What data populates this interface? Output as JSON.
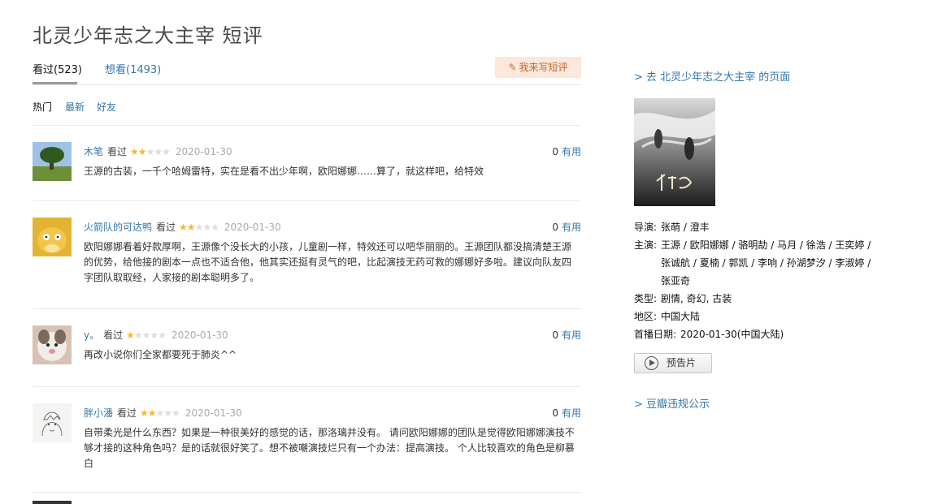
{
  "page": {
    "title": "北灵少年志之大主宰 短评"
  },
  "tabs": {
    "watched": "看过(523)",
    "want": "想看(1493)",
    "write_button": "我来写短评"
  },
  "sort": {
    "hot": "热门",
    "latest": "最新",
    "friends": "好友"
  },
  "comments": [
    {
      "user": "木笔",
      "status": "看过",
      "rating": 2,
      "date": "2020-01-30",
      "votes": "0",
      "votes_label": "有用",
      "text": "王源的古装，一千个哈姆雷特，实在是看不出少年啊，欧阳娜娜……算了，就这样吧，给特效"
    },
    {
      "user": "火箭队的可达鸭",
      "status": "看过",
      "rating": 2,
      "date": "2020-01-30",
      "votes": "0",
      "votes_label": "有用",
      "text": "欧阳娜娜看着好款厚啊，王源像个没长大的小孩，儿童剧一样，特效还可以吧华丽丽的。王源团队都没搞清楚王源的优势，给他接的剧本一点也不适合他，他其实还挺有灵气的吧，比起演技无药可救的娜娜好多啦。建议向队友四字团队取取经，人家接的剧本聪明多了。"
    },
    {
      "user": "y。",
      "status": "看过",
      "rating": 1,
      "date": "2020-01-30",
      "votes": "0",
      "votes_label": "有用",
      "text": "再改小说你们全家都要死于肺炎^^"
    },
    {
      "user": "胖小潘",
      "status": "看过",
      "rating": 2,
      "date": "2020-01-30",
      "votes": "0",
      "votes_label": "有用",
      "text": "自带柔光是什么东西？如果是一种很美好的感觉的话，那洛璃并没有。 请问欧阳娜娜的团队是觉得欧阳娜娜演技不够才接的这种角色吗？是的话就很好笑了。想不被嘲演技烂只有一个办法：提高演技。 个人比较喜欢的角色是柳慕白"
    }
  ],
  "sidebar": {
    "goto_link": "> 去 北灵少年志之大主宰 的页面",
    "director_label": "导演:",
    "director": "张萌 / 澄丰",
    "cast_label": "主演:",
    "cast": "王源 / 欧阳娜娜 / 骆明劼 / 马月 / 徐浩 / 王奕婷 / 张诚航 / 夏楠 / 郭凯 / 李响 / 孙湖梦汐 / 李淑婷 / 张亚奇",
    "genre_label": "类型:",
    "genre": "剧情, 奇幻, 古装",
    "region_label": "地区:",
    "region": "中国大陆",
    "premiere_label": "首播日期:",
    "premiere": "2020-01-30(中国大陆)",
    "trailer_label": "预告片",
    "rules_link": "> 豆瓣违规公示"
  },
  "colors": {
    "link": "#3377aa",
    "star_on": "#f4b634",
    "star_off": "#dddddd",
    "write_button_bg": "#fbe7dc"
  }
}
